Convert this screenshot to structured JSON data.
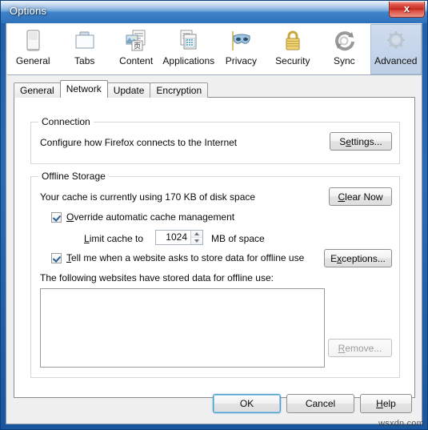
{
  "window": {
    "title": "Options",
    "close_label": "x",
    "accent_title_bar": "#2f72bd",
    "accent_close": "#c3281c",
    "watermark": "wsxdn.com"
  },
  "toolbar": {
    "items": [
      {
        "label": "General",
        "icon": "browser-window-icon",
        "selected": false
      },
      {
        "label": "Tabs",
        "icon": "folder-tab-icon",
        "selected": false
      },
      {
        "label": "Content",
        "icon": "content-pages-icon",
        "selected": false
      },
      {
        "label": "Applications",
        "icon": "applications-grid-icon",
        "selected": false
      },
      {
        "label": "Privacy",
        "icon": "mask-icon",
        "selected": false
      },
      {
        "label": "Security",
        "icon": "padlock-icon",
        "selected": false
      },
      {
        "label": "Sync",
        "icon": "sync-arrows-icon",
        "selected": false
      },
      {
        "label": "Advanced",
        "icon": "gear-icon",
        "selected": true
      }
    ]
  },
  "subtabs": [
    {
      "label": "General",
      "selected": false
    },
    {
      "label": "Network",
      "selected": true
    },
    {
      "label": "Update",
      "selected": false
    },
    {
      "label": "Encryption",
      "selected": false
    }
  ],
  "connection": {
    "group_title": "Connection",
    "description": "Configure how Firefox connects to the Internet",
    "settings_button": {
      "prefix": "S",
      "accesskey": "e",
      "suffix": "ttings..."
    }
  },
  "offline_storage": {
    "group_title": "Offline Storage",
    "cache_usage_text": "Your cache is currently using 170 KB of disk space",
    "clear_now_button": {
      "prefix": "",
      "accesskey": "C",
      "suffix": "lear Now"
    },
    "override_checkbox": {
      "checked": true,
      "prefix": "",
      "accesskey": "O",
      "suffix": "verride automatic cache management"
    },
    "limit_cache": {
      "label_prefix": "",
      "label_accesskey": "L",
      "label_suffix": "imit cache to",
      "value": "1024",
      "unit": "MB of space"
    },
    "tell_me_checkbox": {
      "checked": true,
      "prefix": "",
      "accesskey": "T",
      "suffix": "ell me when a website asks to store data for offline use"
    },
    "exceptions_button": {
      "prefix": "E",
      "accesskey": "x",
      "suffix": "ceptions..."
    },
    "sites_label": "The following websites have stored data for offline use:",
    "sites_list": [],
    "remove_button": {
      "prefix": "",
      "accesskey": "R",
      "suffix": "emove...",
      "disabled": true
    }
  },
  "footer": {
    "ok_button": {
      "label": "OK",
      "default": true
    },
    "cancel_button": {
      "label": "Cancel"
    },
    "help_button": {
      "prefix": "",
      "accesskey": "H",
      "suffix": "elp"
    }
  }
}
